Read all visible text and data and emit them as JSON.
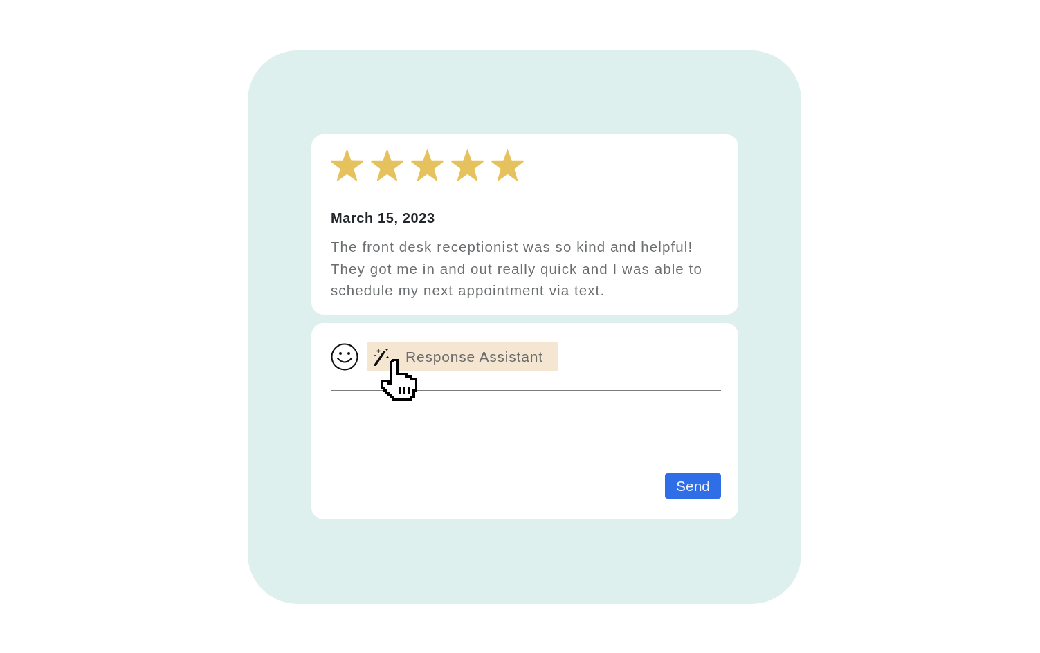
{
  "review": {
    "stars": 5,
    "date": "March 15, 2023",
    "text": "The front desk receptionist was so kind and helpful! They got me in and out really quick and I was able to schedule my next appointment via text."
  },
  "reply": {
    "assistant_button": "Response Assistant",
    "send_button": "Send"
  }
}
